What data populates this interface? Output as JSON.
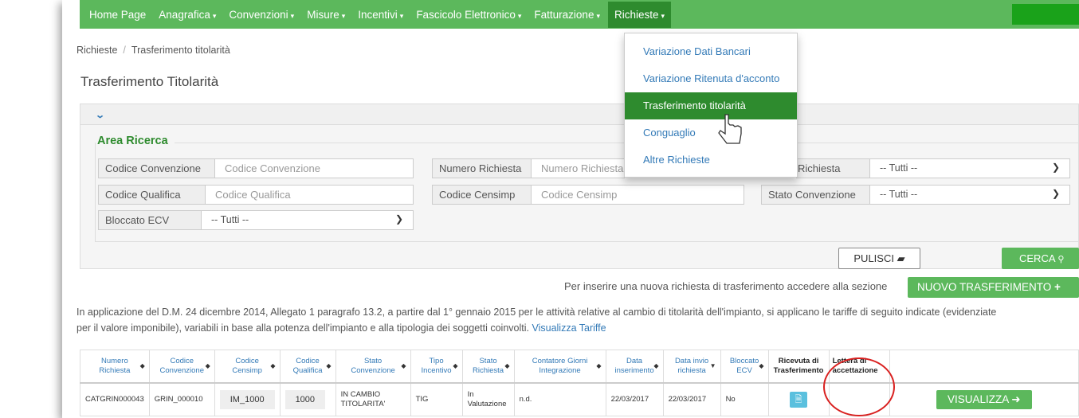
{
  "navbar": {
    "items": [
      "Home Page",
      "Anagrafica",
      "Convenzioni",
      "Misure",
      "Incentivi",
      "Fascicolo Elettronico",
      "Fatturazione",
      "Richieste"
    ]
  },
  "breadcrumb": {
    "parent": "Richieste",
    "current": "Trasferimento titolarità"
  },
  "page_title": "Trasferimento Titolarità",
  "search": {
    "legend": "Area Ricerca",
    "codice_convenzione": {
      "label": "Codice Convenzione",
      "placeholder": "Codice Convenzione"
    },
    "numero_richiesta": {
      "label": "Numero Richiesta",
      "placeholder": "Numero Richiesta"
    },
    "stato_richiesta": {
      "label": "Richiesta",
      "value": "-- Tutti --"
    },
    "codice_qualifica": {
      "label": "Codice Qualifica",
      "placeholder": "Codice Qualifica"
    },
    "codice_censimp": {
      "label": "Codice Censimp",
      "placeholder": "Codice Censimp"
    },
    "stato_convenzione": {
      "label": "Stato Convenzione",
      "value": "-- Tutti --"
    },
    "bloccato_ecv": {
      "label": "Bloccato ECV",
      "value": "-- Tutti --"
    }
  },
  "buttons": {
    "pulisci": "PULISCI",
    "cerca": "CERCA",
    "nuovo": "NUOVO TRASFERIMENTO"
  },
  "info_line": "Per inserire una nuova richiesta di trasferimento accedere alla sezione",
  "paragraph": {
    "line1": "In applicazione del D.M. 24 dicembre 2014, Allegato 1 paragrafo 13.2, a partire dal 1° gennaio 2015 per le attività relative al cambio di titolarità dell'impianto, si applicano le tariffe di seguito indicate (evidenziate",
    "line2": "per il valore imponibile), variabili in base alla potenza dell'impianto e alla tipologia dei soggetti coinvolti.",
    "link": "Visualizza Tariffe"
  },
  "table": {
    "headers": [
      [
        "Numero",
        "Richiesta"
      ],
      [
        "Codice",
        "Convenzione"
      ],
      [
        "Codice",
        "Censimp"
      ],
      [
        "Codice",
        "Qualifica"
      ],
      [
        "Stato",
        "Convenzione"
      ],
      [
        "Tipo",
        "Incentivo"
      ],
      [
        "Stato",
        "Richiesta"
      ],
      [
        "Contatore Giorni",
        "Integrazione"
      ],
      [
        "Data",
        "inserimento"
      ],
      [
        "Data invio",
        "richiesta"
      ],
      [
        "Bloccato",
        "ECV"
      ],
      [
        "Ricevuta di",
        "Trasferimento"
      ],
      [
        "Lettera di",
        "accettazione"
      ]
    ],
    "row": {
      "numero_richiesta": "CATGRIN000043",
      "codice_convenzione": "GRIN_000010",
      "codice_censimp": "IM_1000",
      "codice_qualifica": "1000",
      "stato_convenzione_1": "IN CAMBIO",
      "stato_convenzione_2": "TITOLARITA'",
      "tipo_incentivo": "TIG",
      "stato_richiesta": "In Valutazione",
      "contatore": "n.d.",
      "data_inserimento": "22/03/2017",
      "data_invio": "22/03/2017",
      "bloccato_ecv": "No",
      "visualizza": "VISUALIZZA"
    }
  },
  "dropdown": {
    "items": [
      "Variazione Dati Bancari",
      "Variazione Ritenuta d'acconto",
      "Trasferimento titolarità",
      "Conguaglio",
      "Altre Richieste"
    ],
    "active_index": 2
  },
  "colors": {
    "primary_green": "#5cb85c",
    "active_green": "#2e8b2e",
    "link_blue": "#337ab7",
    "highlight_red": "#d9201f"
  }
}
